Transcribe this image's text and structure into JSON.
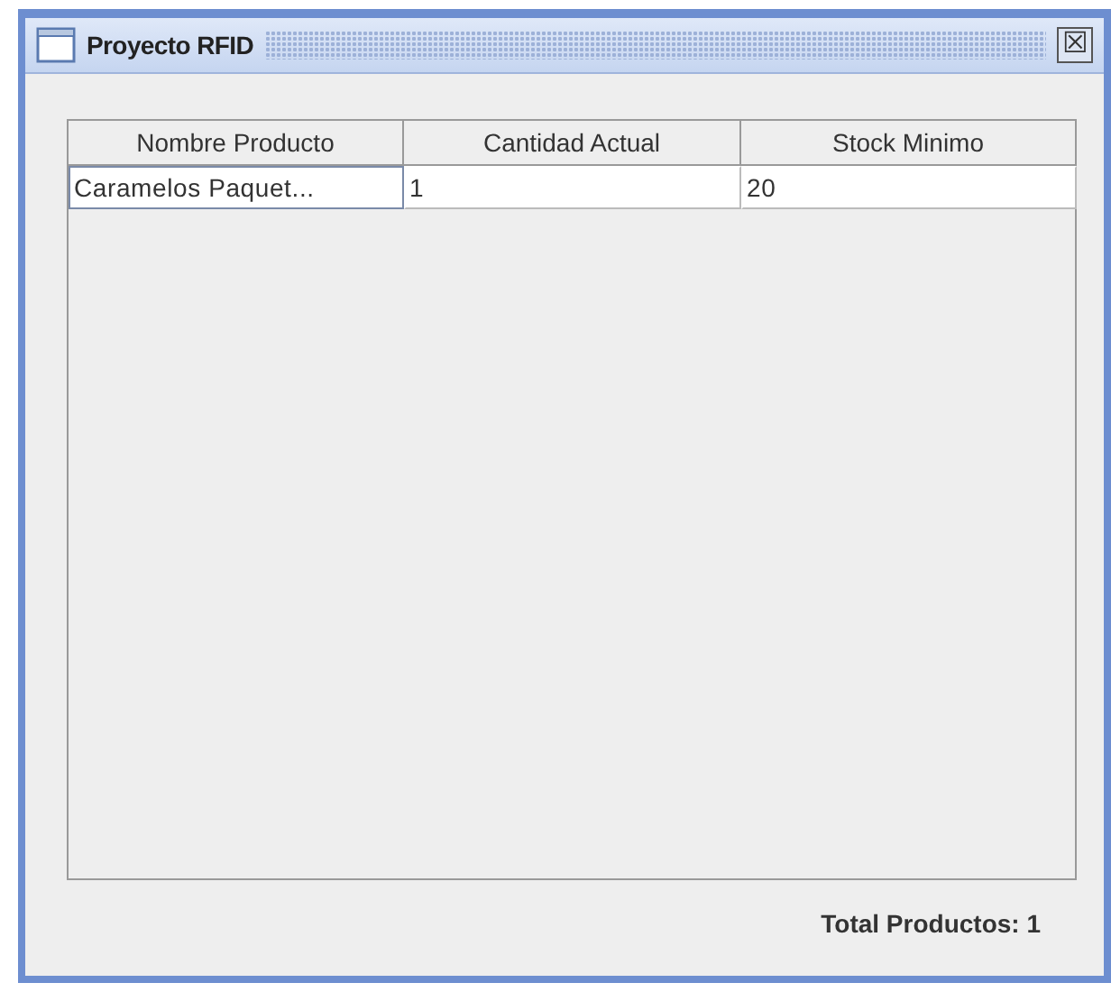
{
  "window": {
    "title": "Proyecto RFID",
    "close": "☒"
  },
  "table": {
    "columns": [
      "Nombre Producto",
      "Cantidad Actual",
      "Stock Minimo"
    ],
    "rows": [
      {
        "cells": [
          {
            "text": "Caramelos Paquet...",
            "focused": true
          },
          {
            "text": "1",
            "focused": false
          },
          {
            "text": "20",
            "focused": false
          }
        ]
      }
    ]
  },
  "footer": {
    "total": "Total Productos: 1"
  }
}
